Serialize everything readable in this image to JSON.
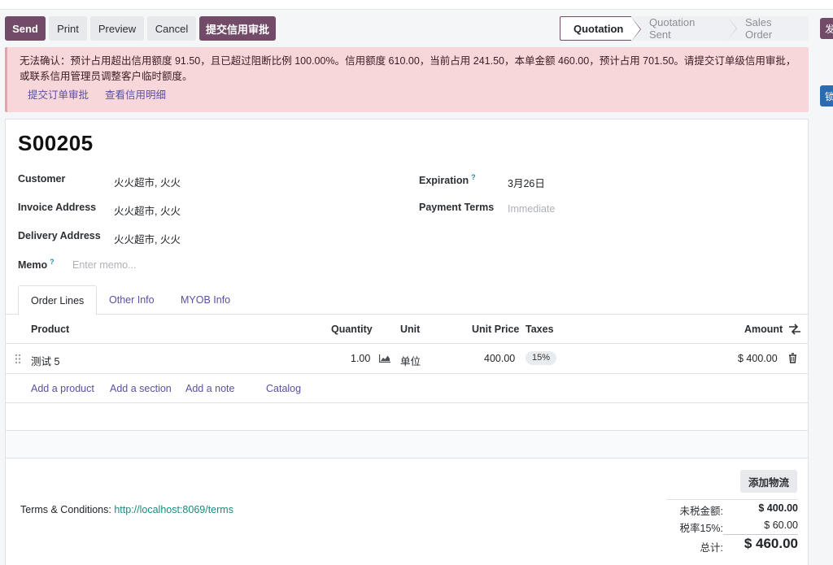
{
  "toolbar": {
    "send": "Send",
    "print": "Print",
    "preview": "Preview",
    "cancel": "Cancel",
    "submit_credit": "提交信用审批"
  },
  "status_stages": [
    "Quotation",
    "Quotation Sent",
    "Sales Order"
  ],
  "right_stubs": [
    "发",
    "锁"
  ],
  "alert": {
    "message": "无法确认：预计占用超出信用额度 91.50，且已超过阻断比例 100.00%。信用额度 610.00，当前占用 241.50，本单金额 460.00，预计占用 701.50。请提交订单级信用审批，或联系信用管理员调整客户临时额度。",
    "link_submit": "提交订单审批",
    "link_view": "查看信用明细"
  },
  "order": {
    "name": "S00205",
    "customer_label": "Customer",
    "customer": "火火超市, 火火",
    "invoice_label": "Invoice Address",
    "invoice": "火火超市, 火火",
    "delivery_label": "Delivery Address",
    "delivery": "火火超市, 火火",
    "memo_label": "Memo",
    "memo_placeholder": "Enter memo...",
    "expiration_label": "Expiration",
    "expiration": "3月26日",
    "payment_label": "Payment Terms",
    "payment_placeholder": "Immediate",
    "help_mark": "?"
  },
  "tabs": [
    "Order Lines",
    "Other Info",
    "MYOB Info"
  ],
  "table": {
    "headers": {
      "product": "Product",
      "quantity": "Quantity",
      "unit": "Unit",
      "unit_price": "Unit Price",
      "taxes": "Taxes",
      "amount": "Amount"
    },
    "rows": [
      {
        "product": "测试 5",
        "quantity": "1.00",
        "unit": "单位",
        "unit_price": "400.00",
        "tax": "15%",
        "amount": "$ 400.00"
      }
    ],
    "add_links": {
      "product": "Add a product",
      "section": "Add a section",
      "note": "Add a note",
      "catalog": "Catalog"
    }
  },
  "footer": {
    "terms_label": "Terms & Conditions:",
    "terms_link": "http://localhost:8069/terms",
    "logistics_button": "添加物流",
    "untaxed_label": "未税金额:",
    "untaxed": "$ 400.00",
    "tax_label": "税率15%:",
    "tax": "$ 60.00",
    "total_label": "总计:",
    "total": "$ 460.00"
  },
  "colors": {
    "primary": "#714b67",
    "alert_bg": "#f8d7da",
    "link": "#5b4fa3",
    "terms_link": "#1a8a7e"
  }
}
